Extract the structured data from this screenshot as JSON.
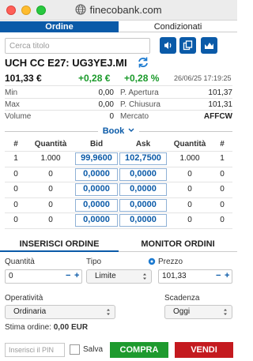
{
  "window": {
    "site": "finecobank.com",
    "globe_icon": "globe-icon"
  },
  "top_tabs": {
    "ordine": "Ordine",
    "condizionati": "Condizionati",
    "active": "Ordine"
  },
  "search": {
    "placeholder": "Cerca titolo",
    "value": ""
  },
  "toolbar_icons": [
    "speaker-icon",
    "copy-icon",
    "chart-icon"
  ],
  "instrument": {
    "name": "UCH CC E27: UG3YEJ.MI",
    "price": "101,33 €",
    "change_abs": "+0,28 €",
    "change_pct": "+0,28 %",
    "timestamp": "26/06/25 17:19:25",
    "positive_color": "#1a9a2a"
  },
  "stats": {
    "min_label": "Min",
    "min_value": "0,00",
    "max_label": "Max",
    "max_value": "0,00",
    "volume_label": "Volume",
    "volume_value": "0",
    "apertura_label": "P. Apertura",
    "apertura_value": "101,37",
    "chiusura_label": "P. Chiusura",
    "chiusura_value": "101,31",
    "mercato_label": "Mercato",
    "mercato_value": "AFFCW"
  },
  "book": {
    "label": "Book",
    "headers": [
      "#",
      "Quantità",
      "Bid",
      "Ask",
      "Quantità",
      "#"
    ],
    "rows": [
      [
        "1",
        "1.000",
        "99,9600",
        "102,7500",
        "1.000",
        "1"
      ],
      [
        "0",
        "0",
        "0,0000",
        "0,0000",
        "0",
        "0"
      ],
      [
        "0",
        "0",
        "0,0000",
        "0,0000",
        "0",
        "0"
      ],
      [
        "0",
        "0",
        "0,0000",
        "0,0000",
        "0",
        "0"
      ],
      [
        "0",
        "0",
        "0,0000",
        "0,0000",
        "0",
        "0"
      ]
    ]
  },
  "order_tabs": {
    "inserisci": "INSERISCI ORDINE",
    "monitor": "MONITOR ORDINI",
    "active": "INSERISCI ORDINE"
  },
  "form": {
    "quantita_label": "Quantità",
    "quantita_value": "0",
    "tipo_label": "Tipo",
    "tipo_value": "Limite",
    "prezzo_label": "Prezzo",
    "prezzo_value": "101,33",
    "operativita_label": "Operatività",
    "operativita_value": "Ordinaria",
    "scadenza_label": "Scadenza",
    "scadenza_value": "Oggi",
    "stima_label": "Stima ordine:",
    "stima_value": "0,00 EUR",
    "minus": "−",
    "plus": "+"
  },
  "footer": {
    "pin_placeholder": "Inserisci il PIN",
    "salva_label": "Salva",
    "compra_label": "COMPRA",
    "vendi_label": "VENDI",
    "compra_color": "#1e9a2e",
    "vendi_color": "#c41a1f"
  }
}
